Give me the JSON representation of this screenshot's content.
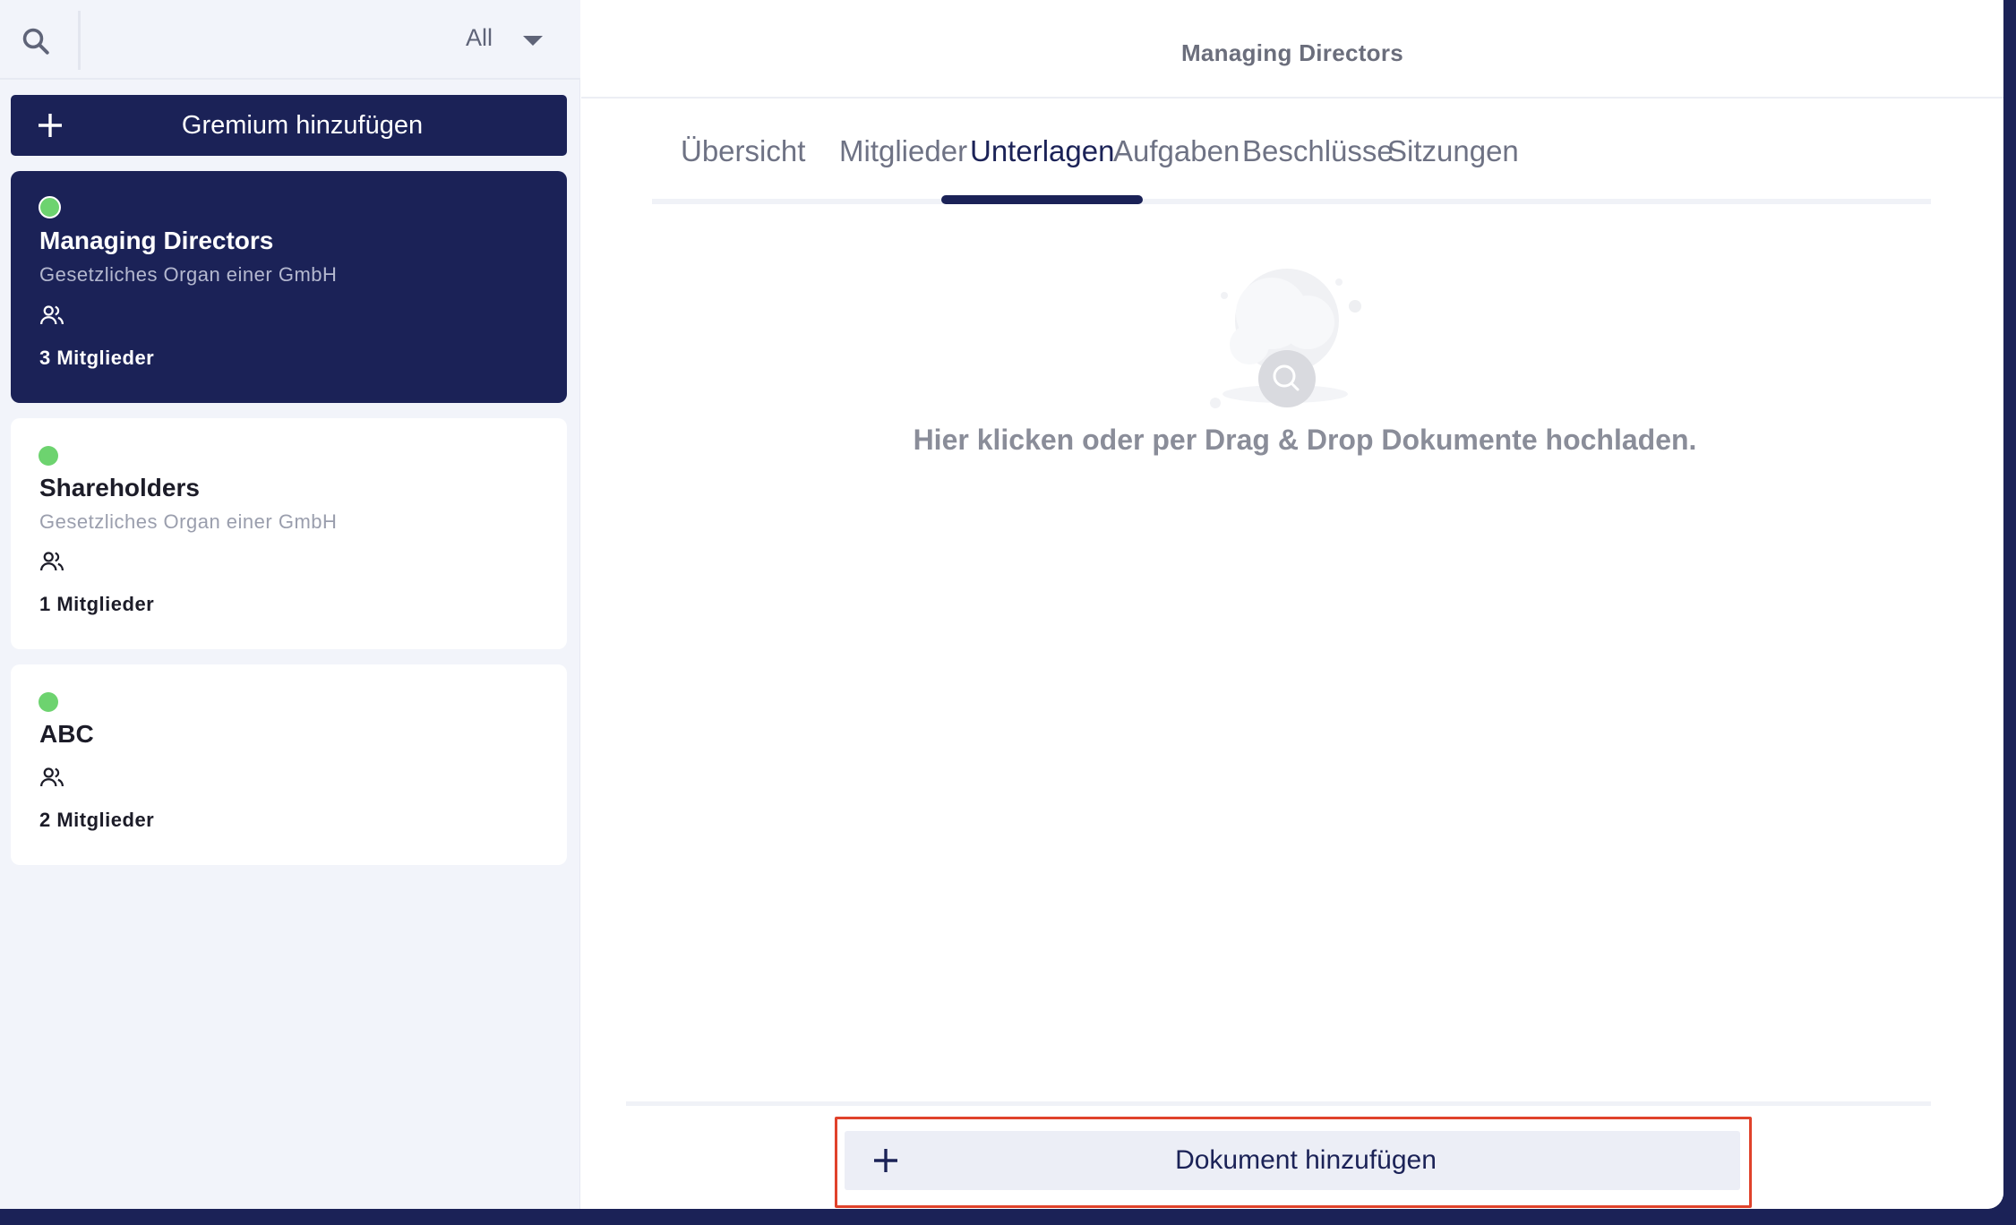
{
  "sidebar": {
    "filter": {
      "selected": "All"
    },
    "add_committee_label": "Gremium hinzufügen",
    "committees": [
      {
        "name": "Managing Directors",
        "description": "Gesetzliches Organ einer GmbH",
        "members": "3 Mitglieder",
        "status_color": "#6dd36f",
        "active": true
      },
      {
        "name": "Shareholders",
        "description": "Gesetzliches Organ einer GmbH",
        "members": "1 Mitglieder",
        "status_color": "#6dd36f",
        "active": false
      },
      {
        "name": "ABC",
        "description": "",
        "members": "2 Mitglieder",
        "status_color": "#6dd36f",
        "active": false
      }
    ]
  },
  "header": {
    "title": "Managing Directors"
  },
  "tabs": [
    {
      "label": "Übersicht",
      "active": false
    },
    {
      "label": "Mitglieder",
      "active": false
    },
    {
      "label": "Unterlagen",
      "active": true
    },
    {
      "label": "Aufgaben",
      "active": false
    },
    {
      "label": "Beschlüsse",
      "active": false
    },
    {
      "label": "Sitzungen",
      "active": false
    }
  ],
  "documents": {
    "empty_text": "Hier klicken oder per Drag & Drop Dokumente hochladen.",
    "add_button_label": "Dokument hinzufügen"
  },
  "colors": {
    "primary": "#1b2257",
    "status_active": "#6dd36f",
    "highlight": "#e0422b"
  }
}
